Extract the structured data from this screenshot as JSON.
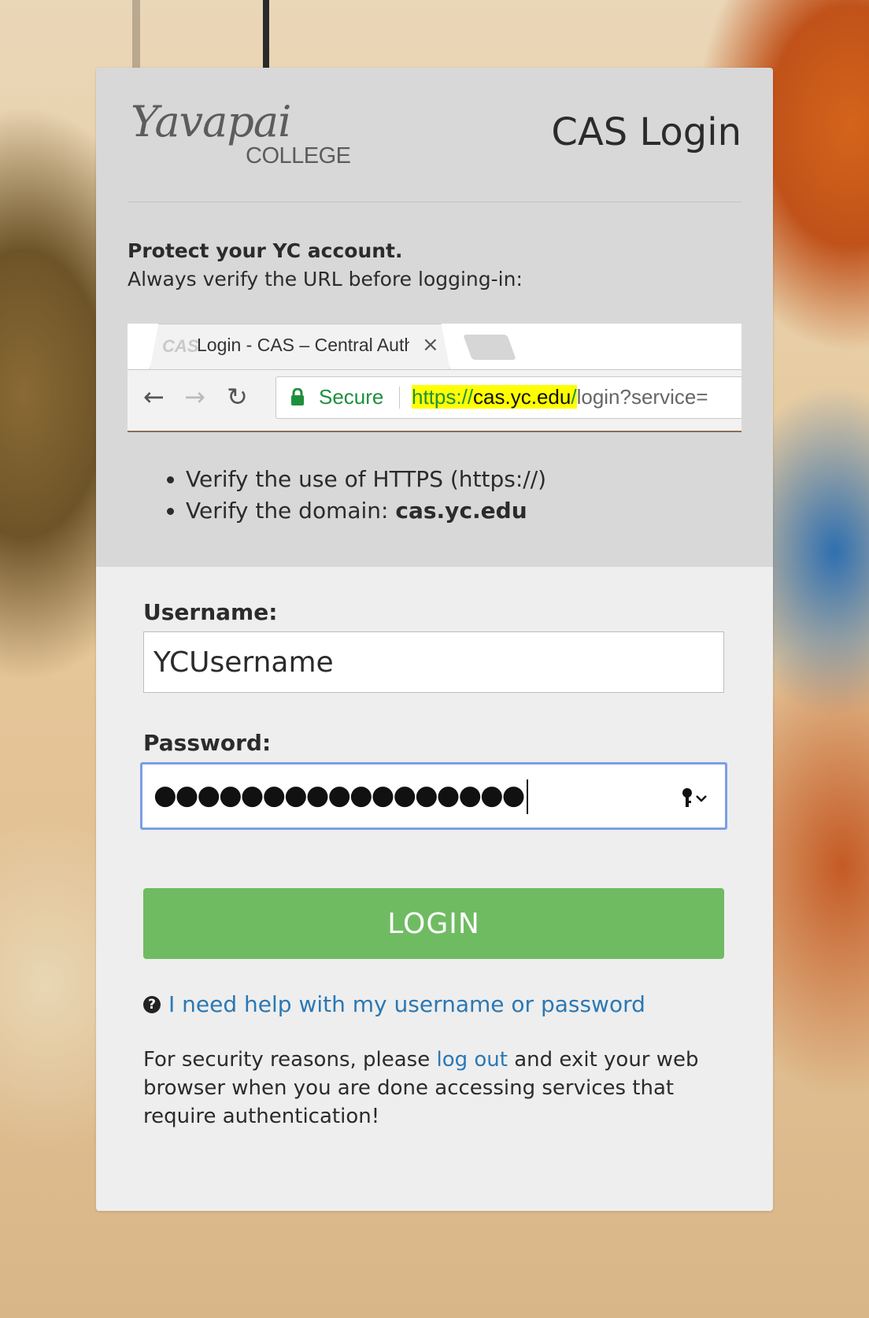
{
  "header": {
    "logo_name": "Yavapai",
    "logo_subtitle": "COLLEGE",
    "title": "CAS Login"
  },
  "notice": {
    "heading": "Protect your YC account.",
    "subheading": "Always verify the URL before logging-in:",
    "bullets": {
      "https": "Verify the use of HTTPS (https://)",
      "domain_prefix": "Verify the domain: ",
      "domain": "cas.yc.edu"
    }
  },
  "browser_example": {
    "tab_icon_text": "CAS",
    "tab_title": "Login - CAS – Central Authentication Service",
    "close_glyph": "×",
    "secure_label": "Secure",
    "url_scheme": "https://",
    "url_host": "cas.yc.edu",
    "url_slash": "/",
    "url_rest": "login?service=",
    "back_glyph": "←",
    "forward_glyph": "→",
    "reload_glyph": "↻"
  },
  "form": {
    "username_label": "Username:",
    "username_value": "YCUsername",
    "password_label": "Password:",
    "password_value": "●●●●●●●●●●●●●●●●●",
    "login_label": "LOGIN"
  },
  "help": {
    "icon_glyph": "?",
    "link_text": "I need help with my username or password"
  },
  "security": {
    "before": "For security reasons, please ",
    "link": "log out",
    "after": " and exit your web browser when you are done accessing services that require authentication!"
  },
  "colors": {
    "login_green": "#6fbb62",
    "link_blue": "#2a78b4",
    "secure_green": "#1e8f3e",
    "highlight_yellow": "#ffff00"
  }
}
